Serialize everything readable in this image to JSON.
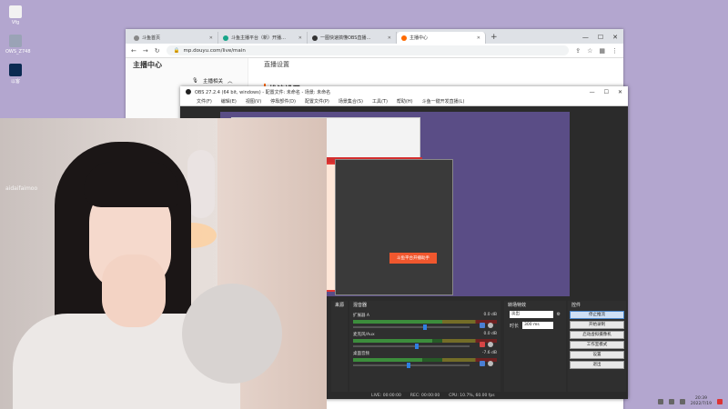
{
  "desktop": {
    "icons": [
      {
        "label": "Vfg"
      },
      {
        "label": "OWS_Z748"
      },
      {
        "label": "以客"
      }
    ]
  },
  "chrome": {
    "tabs": [
      {
        "label": "斗鱼首页"
      },
      {
        "label": "斗鱼主播平台（新）开播…"
      },
      {
        "label": "一图快速搞懂OBS直播…"
      },
      {
        "label": "主播中心"
      }
    ],
    "new_tab": "+",
    "url": "mp.douyu.com/live/main",
    "brand": "主播中心",
    "sidebar_item": "主播相关",
    "top_heading": "直播设置",
    "page_title": "推流设置"
  },
  "obs": {
    "title": "OBS 27.2.4 (64 bit, windows) - 配置文件: 未命名 - 场景: 未命名",
    "menu": [
      "文件(F)",
      "编辑(E)",
      "视图(V)",
      "停靠部件(D)",
      "配置文件(P)",
      "场景集合(S)",
      "工具(T)",
      "帮助(H)",
      "斗鱼一键开发直播(L)"
    ],
    "overlay_label": "斗鱼平台开播助手",
    "mixer": {
      "header": "混音器",
      "tracks": [
        {
          "name": "扩展器 A",
          "db": "0.0 dB",
          "level": 0.62,
          "muted": false
        },
        {
          "name": "麦克风/Aux",
          "db": "0.0 dB",
          "level": 0.55,
          "muted": true
        },
        {
          "name": "桌面音频",
          "db": "-7.6 dB",
          "level": 0.48,
          "muted": false
        }
      ]
    },
    "transitions": {
      "header": "转场特效",
      "select": "淡出",
      "duration_label": "时长",
      "duration": "300 ms"
    },
    "controls": {
      "header": "控件",
      "buttons": [
        "停止推流",
        "开始录制",
        "启动虚拟摄像机",
        "工作室模式",
        "设置",
        "退出"
      ]
    },
    "scenes_header": "来源",
    "status": {
      "dropped": "LIVE: 00:00:00",
      "rec": "REC: 00:00:00",
      "cpu": "CPU: 10.7%, 60.00 fps"
    }
  },
  "webcam": {
    "caption": "aidaifaimoo"
  },
  "taskbar": {
    "time": "20:39",
    "date": "2022/7/19"
  }
}
